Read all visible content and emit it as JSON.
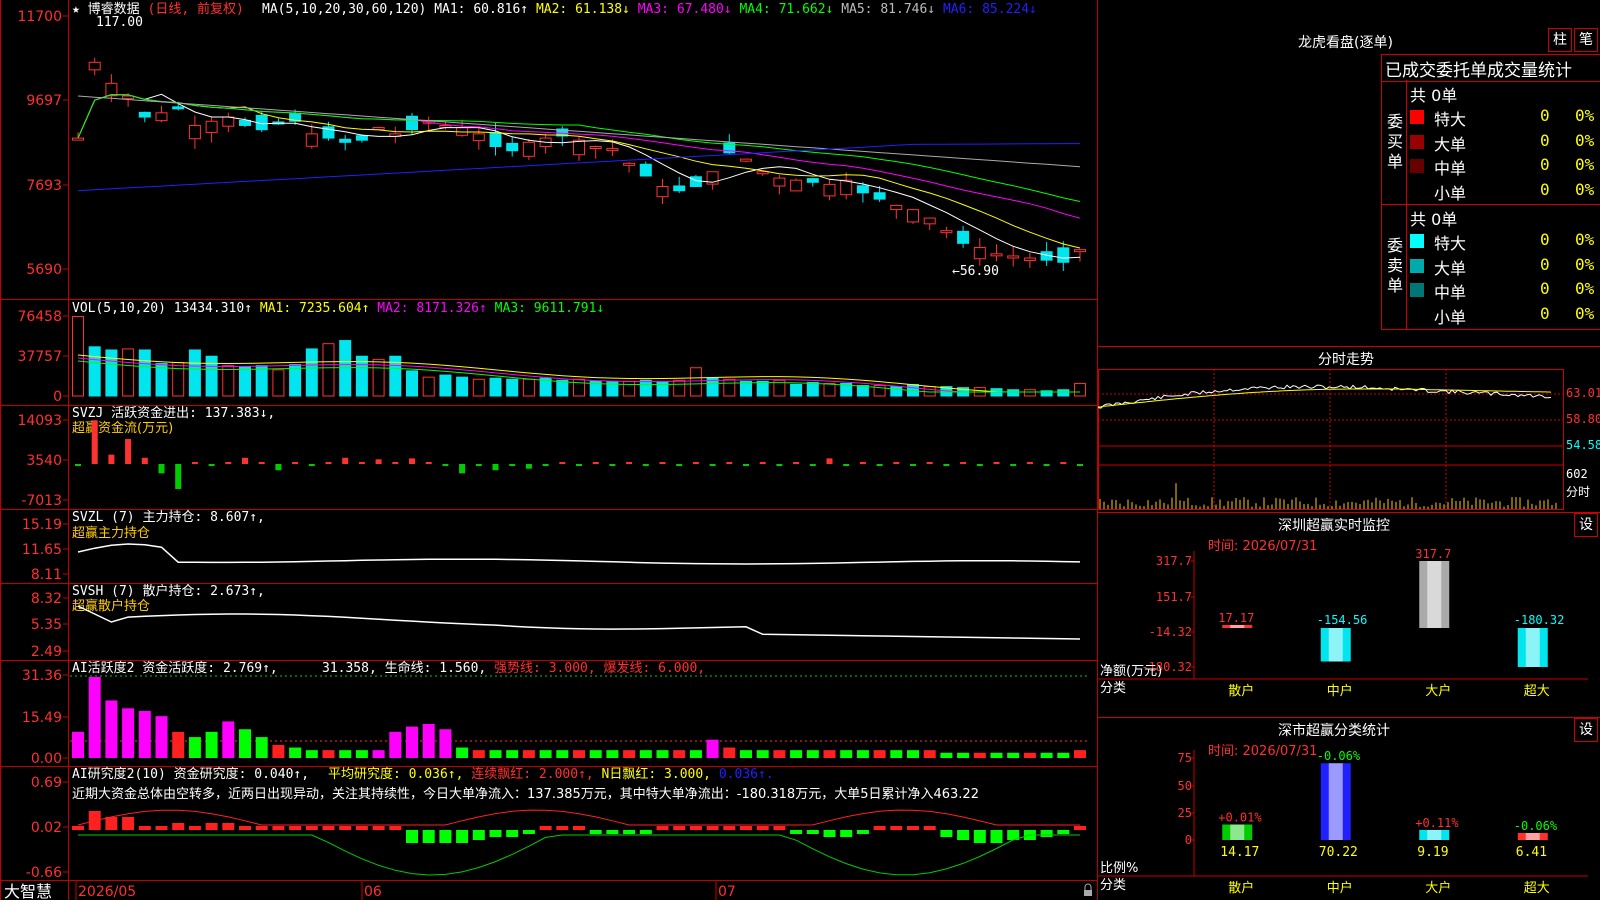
{
  "app": {
    "brand": "大智慧",
    "lock_icon": "lock-icon"
  },
  "colors": {
    "up": "#ff3232",
    "down": "#00e5ee",
    "bg": "#000000",
    "grid": "#b00000",
    "ma1": "#ffffff",
    "ma2": "#ffff00",
    "ma3": "#ff00ff",
    "ma4": "#00ff00",
    "ma5": "#aaaaaa",
    "ma6": "#0000ff",
    "white_text": "#ffffff",
    "yellow": "#ffcc00"
  },
  "kline": {
    "title_star": "★",
    "stock_name": "博睿数据",
    "period": "(日线, 前复权)",
    "ma_label": "MA(5,10,20,30,60,120)",
    "ma_items": [
      {
        "text": "MA1: 60.816↑",
        "color": "#ffffff"
      },
      {
        "text": "MA2: 61.138↓",
        "color": "#ffff00"
      },
      {
        "text": "MA3: 67.480↓",
        "color": "#ff00ff"
      },
      {
        "text": "MA4: 71.662↓",
        "color": "#00ff00"
      },
      {
        "text": "MA5: 81.746↓",
        "color": "#bbbbbb"
      },
      {
        "text": "MA6: 85.224↓",
        "color": "#2020ff"
      }
    ],
    "y_labels": [
      "11700",
      "9697",
      "7693",
      "5690"
    ],
    "high_marker": "117.00",
    "low_marker": "←56.90",
    "x_labels": [
      "2026/05",
      "06",
      "07"
    ]
  },
  "vol": {
    "label": "VOL(5,10,20)",
    "value": "13434.310↑",
    "items": [
      {
        "text": "MA1: 7235.604↑",
        "color": "#ffff00"
      },
      {
        "text": "MA2: 8171.326↑",
        "color": "#ff00ff"
      },
      {
        "text": "MA3: 9611.791↓",
        "color": "#00ff00"
      }
    ],
    "y_labels": [
      "76458",
      "37757",
      "0"
    ]
  },
  "svzj": {
    "label": "SVZJ  活跃资金进出: 137.383↓,",
    "sub": "超赢资金流(万元)",
    "y_labels": [
      "14093",
      "3540",
      "-7013"
    ]
  },
  "svzl": {
    "label": "SVZL (7) 主力持仓: 8.607↑,",
    "sub": "超赢主力持仓",
    "y_labels": [
      "15.19",
      "11.65",
      "8.11"
    ]
  },
  "svsh": {
    "label": "SVSH (7) 散户持仓: 2.673↑,",
    "sub": "超赢散户持仓",
    "y_labels": [
      "8.32",
      "5.35",
      "2.49"
    ]
  },
  "ai_active": {
    "label": "AI活跃度2 资金活跃度: 2.769↑,",
    "items": [
      {
        "text": "31.358, 生命线: 1.560,",
        "color": "#ffffff"
      },
      {
        "text": "强势线: 3.000, 爆发线: 6.000,",
        "color": "#ff3030"
      }
    ],
    "y_labels": [
      "31.36",
      "15.49",
      "0.00"
    ]
  },
  "ai_research": {
    "label": "AI研究度2(10) 资金研究度: 0.040↑,",
    "items": [
      {
        "text": "平均研究度: 0.036↑,",
        "color": "#ffff00"
      },
      {
        "text": "连续飘红: 2.000↑,",
        "color": "#ff3030"
      },
      {
        "text": "N日飘红: 3.000,",
        "color": "#ffff00"
      },
      {
        "text": "0.036↑.",
        "color": "#2020ff"
      }
    ],
    "comment": "近期大资金总体由空转多，近两日出现异动，关注其持续性，今日大单净流入：137.385万元，其中特大单净流出：-180.318万元，大单5日累计净入463.22",
    "y_labels": [
      "0.69",
      "0.02",
      "-0.66"
    ]
  },
  "longhu": {
    "title": "龙虎看盘(逐单)",
    "btn_bar": "柱",
    "btn_pen": "笔",
    "header": "已成交委托单成交量统计",
    "buy": {
      "side_label": "委买单",
      "total": "共 0单",
      "rows": [
        {
          "name": "特大",
          "value": "0",
          "pct": "0%",
          "color": "#ff0000"
        },
        {
          "name": "大单",
          "value": "0",
          "pct": "0%",
          "color": "#990000"
        },
        {
          "name": "中单",
          "value": "0",
          "pct": "0%",
          "color": "#660000"
        },
        {
          "name": "小单",
          "value": "0",
          "pct": "0%",
          "color": "#000000"
        }
      ]
    },
    "sell": {
      "side_label": "委卖单",
      "total": "共 0单",
      "rows": [
        {
          "name": "特大",
          "value": "0",
          "pct": "0%",
          "color": "#00ffff"
        },
        {
          "name": "大单",
          "value": "0",
          "pct": "0%",
          "color": "#00aaaa"
        },
        {
          "name": "中单",
          "value": "0",
          "pct": "0%",
          "color": "#007777"
        },
        {
          "name": "小单",
          "value": "0",
          "pct": "0%",
          "color": "#000000"
        }
      ]
    }
  },
  "intraday": {
    "title": "分时走势",
    "y_labels": [
      "63.01",
      "58.80",
      "54.58"
    ],
    "vol_labels": [
      "602",
      "分时"
    ]
  },
  "sz_monitor": {
    "title": "深圳超赢实时监控",
    "settings": "设",
    "time": "时间: 2026/07/31",
    "y_labels": [
      "317.7",
      "151.7",
      "-14.32",
      "-180.32"
    ],
    "y_caption": "净额(万元)",
    "x_caption": "分类",
    "chart_data": {
      "type": "bar",
      "categories": [
        "散户",
        "中户",
        "大户",
        "超大"
      ],
      "values": [
        17.17,
        -154.56,
        317.7,
        -180.32
      ],
      "value_labels": [
        "17.17",
        "-154.56",
        "317.7",
        "-180.32"
      ],
      "ylabel": "净额(万元)",
      "xlabel": "分类"
    }
  },
  "sh_stats": {
    "title": "深市超赢分类统计",
    "settings": "设",
    "time": "时间: 2026/07/31",
    "y_labels": [
      "75",
      "50",
      "25",
      "0"
    ],
    "y_caption": "比例%",
    "x_caption": "分类",
    "chart_data": {
      "type": "bar",
      "categories": [
        "散户",
        "中户",
        "大户",
        "超大"
      ],
      "values": [
        14.17,
        70.22,
        9.19,
        6.41
      ],
      "value_labels": [
        "14.17",
        "70.22",
        "9.19",
        "6.41"
      ],
      "changes": [
        "+0.01%",
        "-0.06%",
        "+0.11%",
        "-0.06%"
      ],
      "ylabel": "比例%",
      "xlabel": "分类",
      "ylim": [
        0,
        75
      ]
    }
  }
}
